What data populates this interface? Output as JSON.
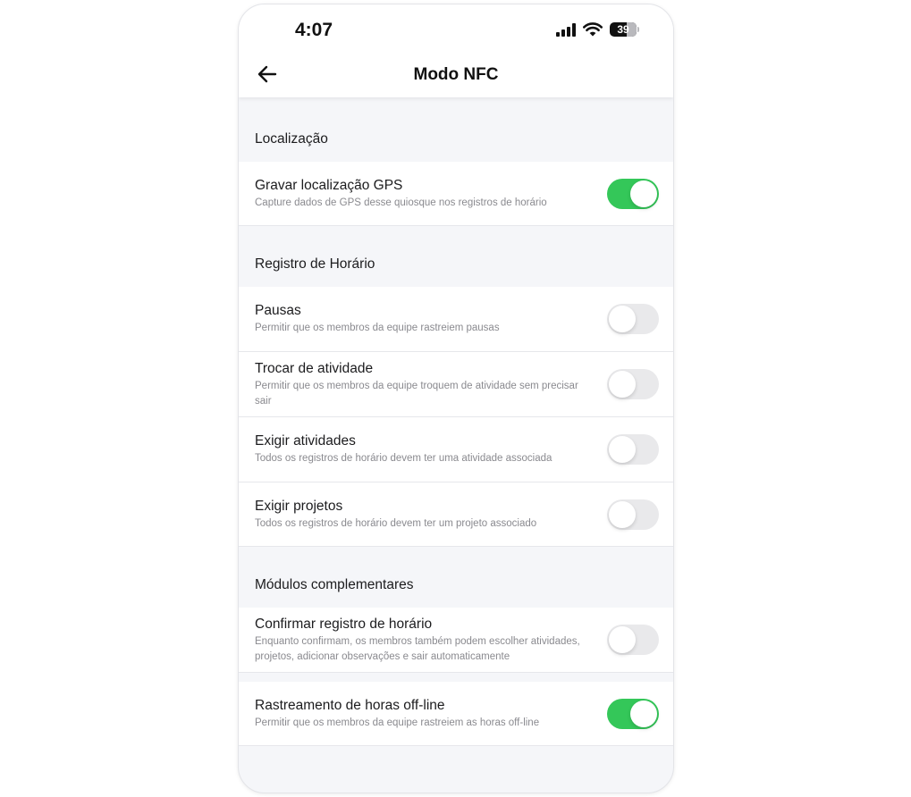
{
  "status_bar": {
    "time": "4:07",
    "battery": "39"
  },
  "nav": {
    "title": "Modo NFC"
  },
  "sections": {
    "location": {
      "header": "Localização",
      "gps": {
        "title": "Gravar localização GPS",
        "desc": "Capture dados de GPS desse quiosque nos registros de horário",
        "enabled": true
      }
    },
    "time_tracking": {
      "header": "Registro de Horário",
      "breaks": {
        "title": "Pausas",
        "desc": "Permitir que os membros da equipe rastreiem pausas",
        "enabled": false
      },
      "switch_activity": {
        "title": "Trocar de atividade",
        "desc": "Permitir que os membros da equipe troquem de atividade sem precisar sair",
        "enabled": false
      },
      "require_activities": {
        "title": "Exigir atividades",
        "desc": "Todos os registros de horário devem ter uma atividade associada",
        "enabled": false
      },
      "require_projects": {
        "title": "Exigir projetos",
        "desc": "Todos os registros de horário devem ter um projeto associado",
        "enabled": false
      }
    },
    "addons": {
      "header": "Módulos complementares",
      "confirm_entry": {
        "title": "Confirmar registro de horário",
        "desc": "Enquanto confirmam, os membros também podem escolher atividades, projetos, adicionar observações e sair automaticamente",
        "enabled": false
      },
      "offline_tracking": {
        "title": "Rastreamento de horas off-line",
        "desc": "Permitir que os membros da equipe rastreiem as horas off-line",
        "enabled": true
      }
    }
  },
  "colors": {
    "toggle_on": "#34c759",
    "toggle_off": "#e9e9eb",
    "background": "#f5f6f9"
  }
}
